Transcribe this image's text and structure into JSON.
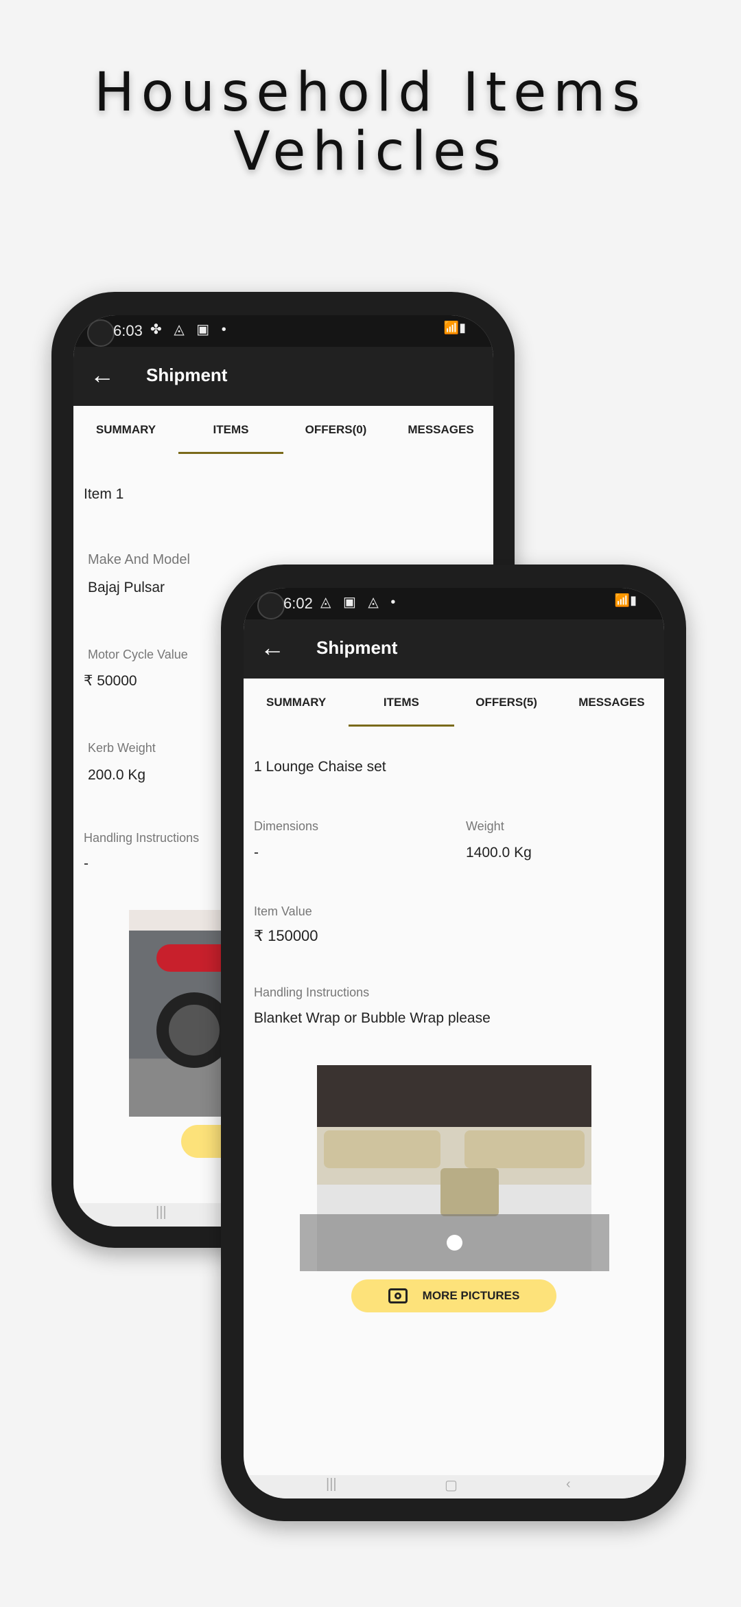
{
  "headline": {
    "line1": "Household Items",
    "line2": "Vehicles"
  },
  "back_phone": {
    "status": {
      "time": "6:03",
      "icons": "✤ ◬ ▣ •",
      "right": "wifi signal battery"
    },
    "appbar": {
      "title": "Shipment"
    },
    "tabs": [
      {
        "label": "SUMMARY"
      },
      {
        "label": "ITEMS",
        "active": true
      },
      {
        "label": "OFFERS(0)"
      },
      {
        "label": "MESSAGES"
      }
    ],
    "item_title": "Item 1",
    "fields": {
      "make_label": "Make And Model",
      "make_value": "Bajaj Pulsar",
      "value_label": "Motor Cycle Value",
      "value": "₹  50000",
      "kerb_label": "Kerb Weight",
      "kerb_value": "200.0 Kg",
      "handling_label": "Handling Instructions",
      "handling_value": "-"
    }
  },
  "front_phone": {
    "status": {
      "time": "6:02",
      "icons": "◬ ▣ ◬ •"
    },
    "appbar": {
      "title": "Shipment"
    },
    "tabs": [
      {
        "label": "SUMMARY"
      },
      {
        "label": "ITEMS",
        "active": true
      },
      {
        "label": "OFFERS(5)"
      },
      {
        "label": "MESSAGES"
      }
    ],
    "item_title": "1 Lounge Chaise set",
    "fields": {
      "dimensions_label": "Dimensions",
      "dimensions_value": "-",
      "weight_label": "Weight",
      "weight_value": "1400.0 Kg",
      "value_label": "Item Value",
      "value": "₹ 150000",
      "handling_label": "Handling Instructions",
      "handling_value": "Blanket Wrap or Bubble Wrap please"
    },
    "more_pictures": "MORE PICTURES",
    "carousel": {
      "current": 1,
      "total": 1
    }
  },
  "colors": {
    "accent_button": "#fde27a",
    "tab_indicator": "#7a6a1a",
    "appbar": "#212121"
  }
}
